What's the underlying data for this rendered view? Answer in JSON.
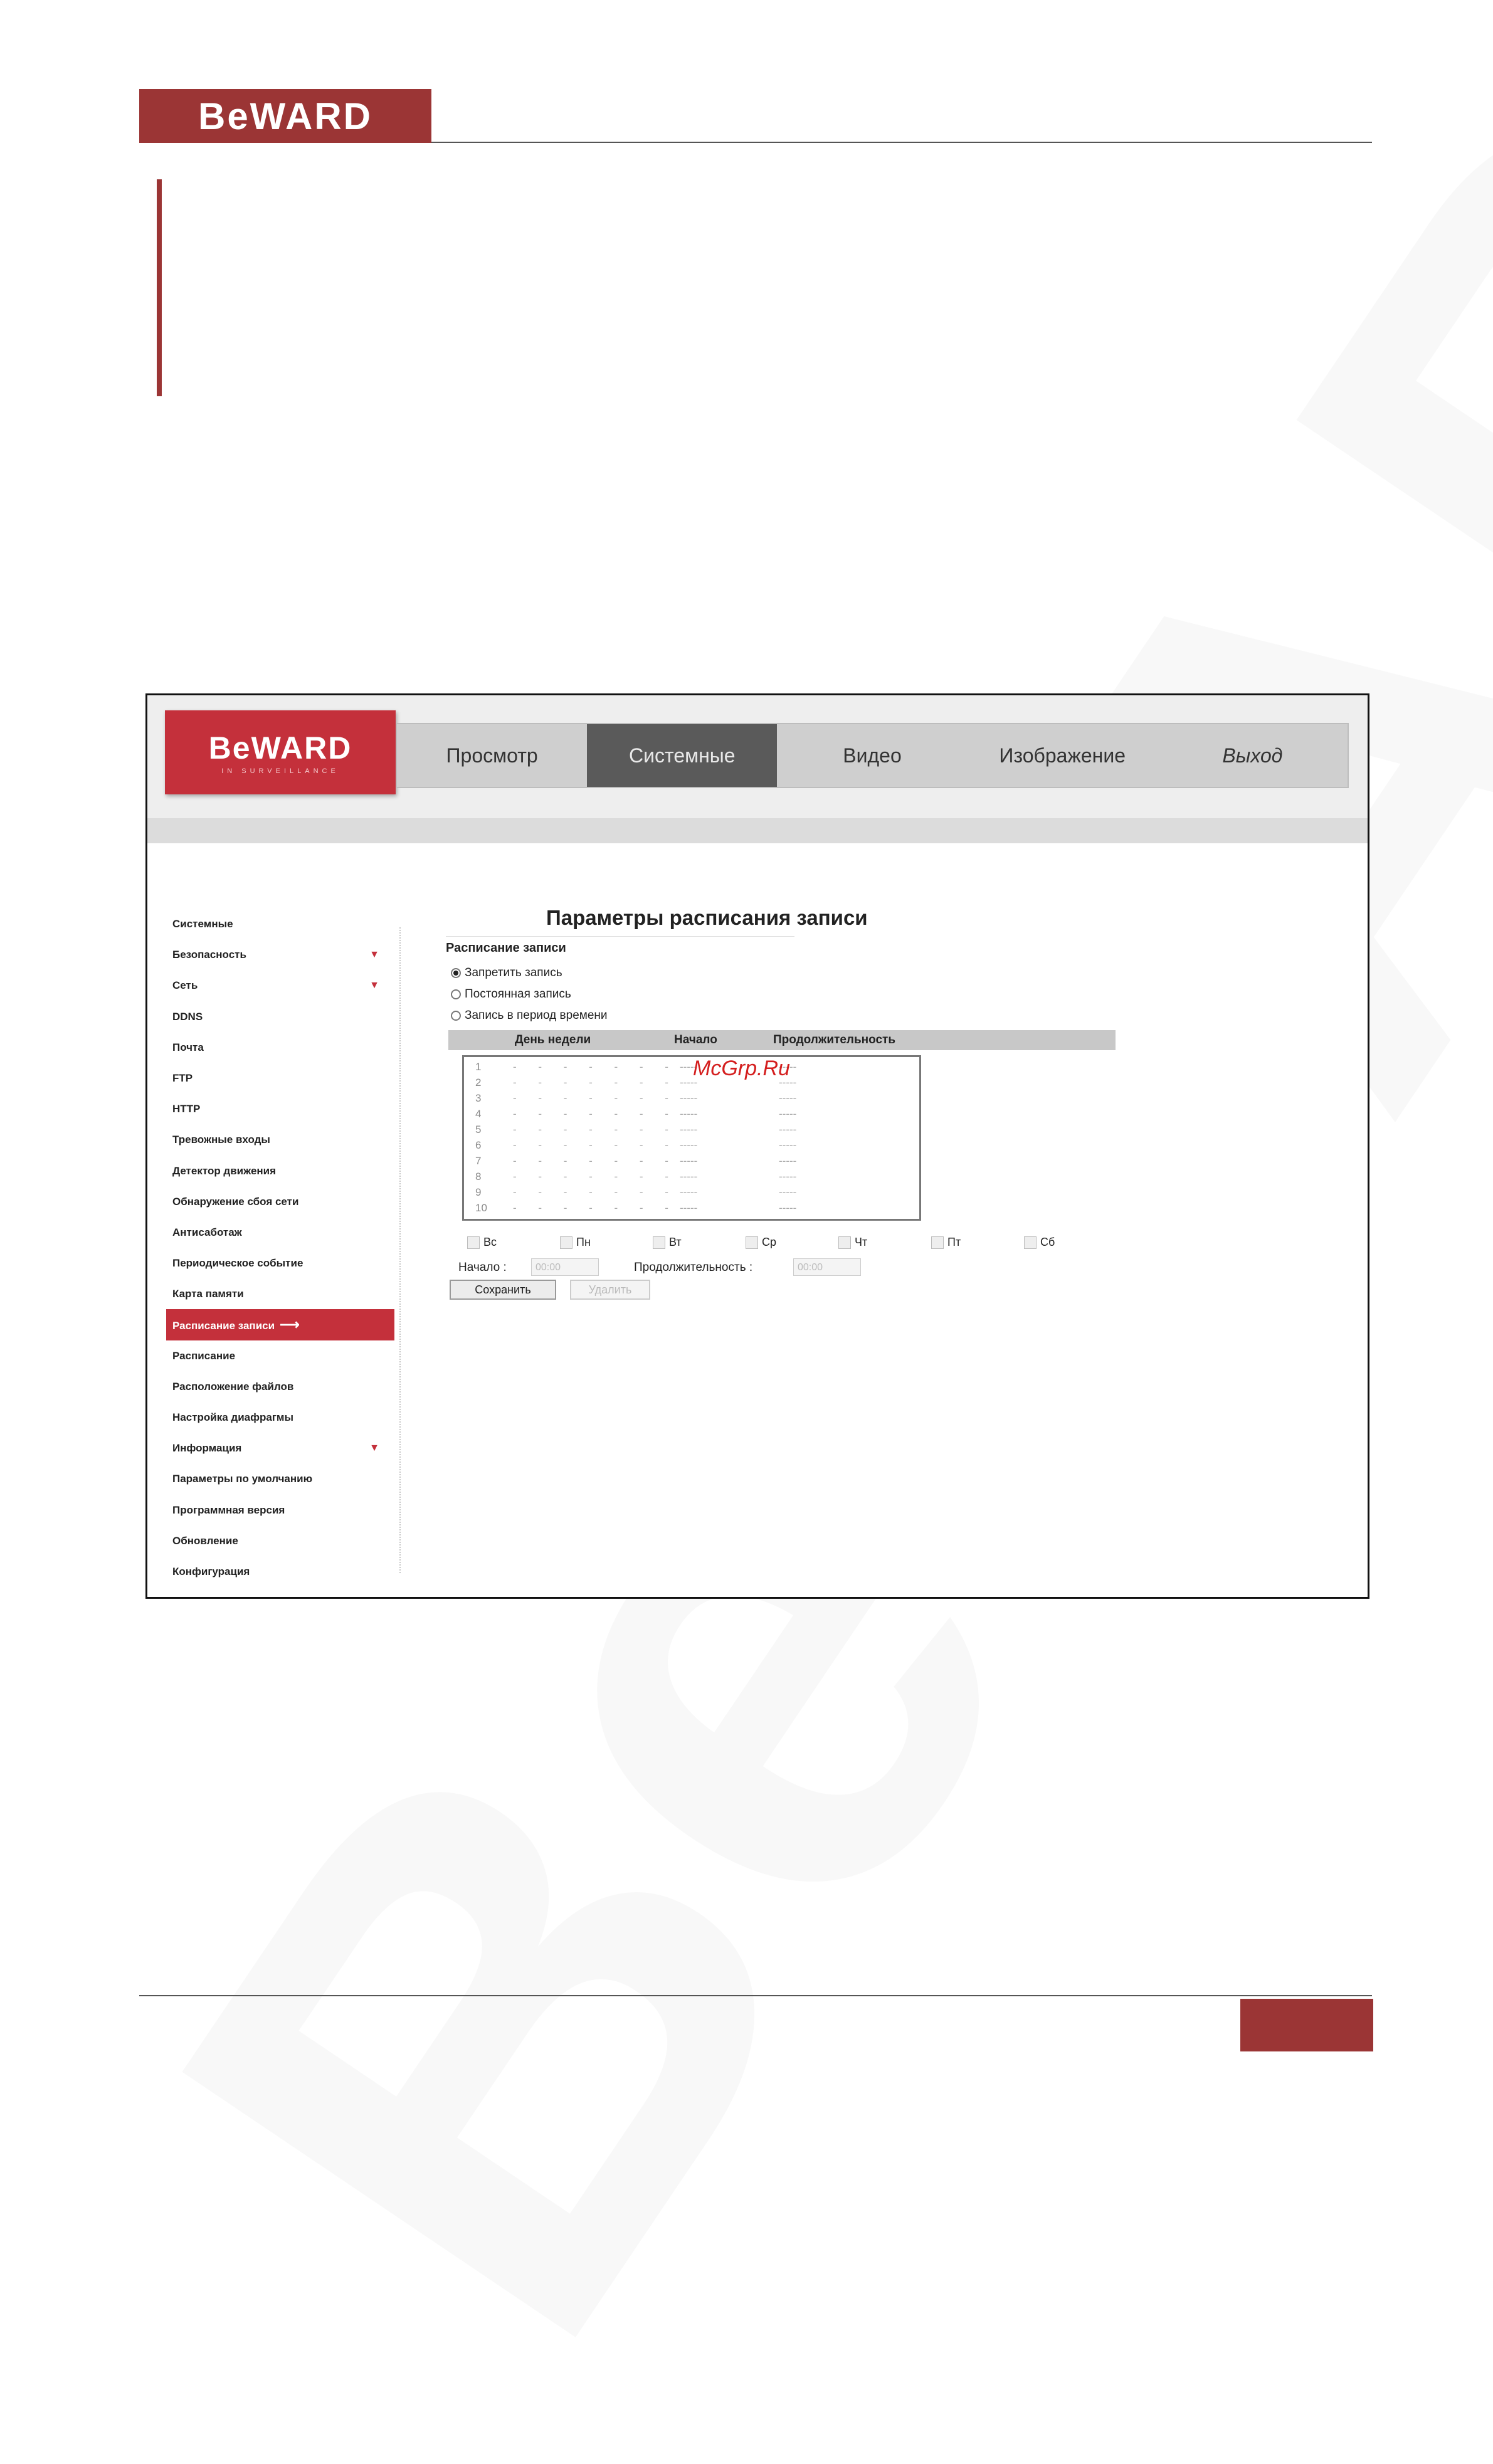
{
  "header": {
    "logo": "BeWARD"
  },
  "colors": {
    "brand": "#9b3535",
    "accent": "#c4303b",
    "active_tab": "#5a5a5a"
  },
  "screenshot": {
    "app_logo": {
      "brand": "BeWARD",
      "sub": "IN SURVEILLANCE"
    },
    "nav": {
      "tabs": [
        {
          "label": "Просмотр"
        },
        {
          "label": "Системные",
          "active": true
        },
        {
          "label": "Видео"
        },
        {
          "label": "Изображение"
        },
        {
          "label": "Выход"
        }
      ]
    },
    "menu": {
      "items": [
        {
          "label": "Системные"
        },
        {
          "label": "Безопасность",
          "arrow": "▼"
        },
        {
          "label": "Сеть",
          "arrow": "▼"
        },
        {
          "label": "DDNS"
        },
        {
          "label": "Почта"
        },
        {
          "label": "FTP"
        },
        {
          "label": "HTTP"
        },
        {
          "label": "Тревожные входы"
        },
        {
          "label": "Детектор движения"
        },
        {
          "label": "Обнаружение сбоя сети"
        },
        {
          "label": "Антисаботаж"
        },
        {
          "label": "Периодическое событие"
        },
        {
          "label": "Карта памяти"
        },
        {
          "label": "Расписание записи",
          "active": true,
          "arrow": "⟶"
        },
        {
          "label": "Расписание"
        },
        {
          "label": "Расположение файлов"
        },
        {
          "label": "Настройка диафрагмы"
        },
        {
          "label": "Информация",
          "arrow": "▼"
        },
        {
          "label": "Параметры по умолчанию"
        },
        {
          "label": "Программная версия"
        },
        {
          "label": "Обновление"
        },
        {
          "label": "Конфигурация"
        }
      ]
    },
    "main": {
      "title": "Параметры расписания записи",
      "section_label": "Расписание записи",
      "radios": [
        {
          "label": "Запретить запись",
          "checked": true
        },
        {
          "label": "Постоянная запись",
          "checked": false
        },
        {
          "label": "Запись в период времени",
          "checked": false
        }
      ],
      "table_headers": {
        "day": "День недели",
        "start": "Начало",
        "duration": "Продолжительность"
      },
      "rows": [
        {
          "n": "1",
          "days": "- - - - - - -",
          "start": "-----",
          "duration": "-----"
        },
        {
          "n": "2",
          "days": "- - - - - - -",
          "start": "-----",
          "duration": "-----"
        },
        {
          "n": "3",
          "days": "- - - - - - -",
          "start": "-----",
          "duration": "-----"
        },
        {
          "n": "4",
          "days": "- - - - - - -",
          "start": "-----",
          "duration": "-----"
        },
        {
          "n": "5",
          "days": "- - - - - - -",
          "start": "-----",
          "duration": "-----"
        },
        {
          "n": "6",
          "days": "- - - - - - -",
          "start": "-----",
          "duration": "-----"
        },
        {
          "n": "7",
          "days": "- - - - - - -",
          "start": "-----",
          "duration": "-----"
        },
        {
          "n": "8",
          "days": "- - - - - - -",
          "start": "-----",
          "duration": "-----"
        },
        {
          "n": "9",
          "days": "- - - - - - -",
          "start": "-----",
          "duration": "-----"
        },
        {
          "n": "10",
          "days": "- - - - - - -",
          "start": "-----",
          "duration": "-----"
        }
      ],
      "days": [
        "Вс",
        "Пн",
        "Вт",
        "Ср",
        "Чт",
        "Пт",
        "Сб"
      ],
      "start_label": "Начало :",
      "start_value": "00:00",
      "duration_label": "Продолжительность :",
      "duration_value": "00:00",
      "save_label": "Сохранить",
      "delete_label": "Удалить"
    },
    "watermark_text": "McGrp.Ru"
  }
}
